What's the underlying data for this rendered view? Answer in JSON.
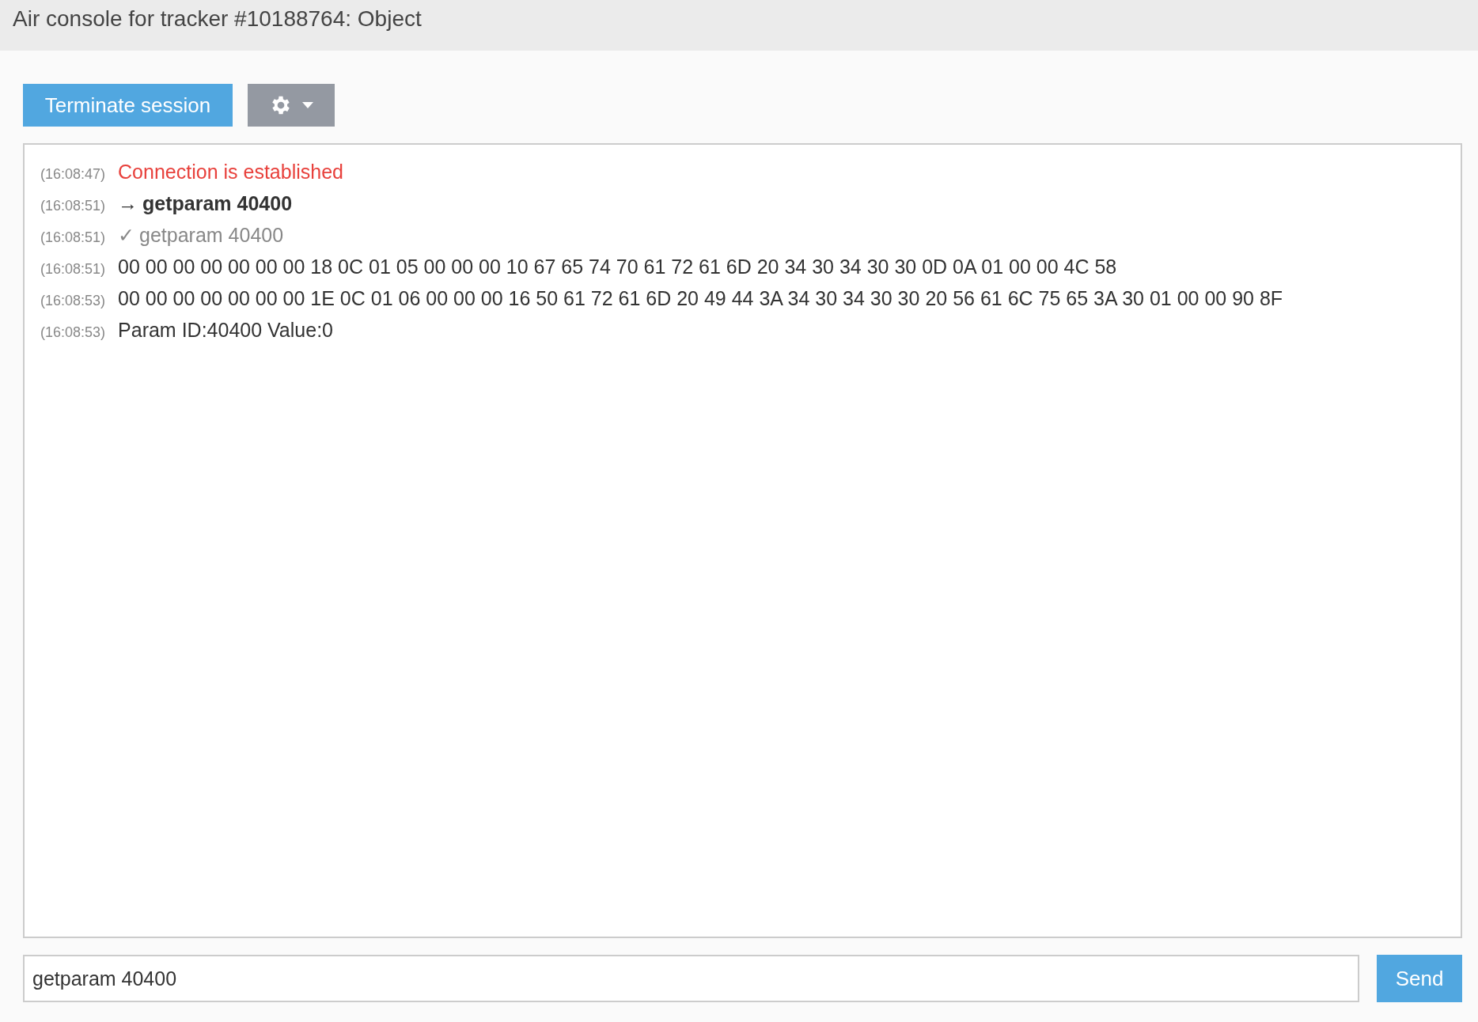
{
  "window": {
    "title": "Air console for tracker #10188764: Object"
  },
  "toolbar": {
    "terminate_button": "Terminate session"
  },
  "log": [
    {
      "time": "(16:08:47)",
      "kind": "status",
      "text": "Connection is established"
    },
    {
      "time": "(16:08:51)",
      "kind": "sent",
      "marker": "→",
      "text": "getparam 40400"
    },
    {
      "time": "(16:08:51)",
      "kind": "ack",
      "marker": "✓",
      "text": "getparam 40400"
    },
    {
      "time": "(16:08:51)",
      "kind": "data",
      "text": "00 00 00 00 00 00 00 18 0C 01 05 00 00 00 10 67 65 74 70 61 72 61 6D 20 34 30 34 30 30 0D 0A 01 00 00 4C 58"
    },
    {
      "time": "(16:08:53)",
      "kind": "data",
      "text": "00 00 00 00 00 00 00 1E 0C 01 06 00 00 00 16 50 61 72 61 6D 20 49 44 3A 34 30 34 30 30 20 56 61 6C 75 65 3A 30 01 00 00 90 8F"
    },
    {
      "time": "(16:08:53)",
      "kind": "data",
      "text": "Param ID:40400 Value:0"
    }
  ],
  "command": {
    "value": "getparam 40400",
    "send_button": "Send"
  }
}
